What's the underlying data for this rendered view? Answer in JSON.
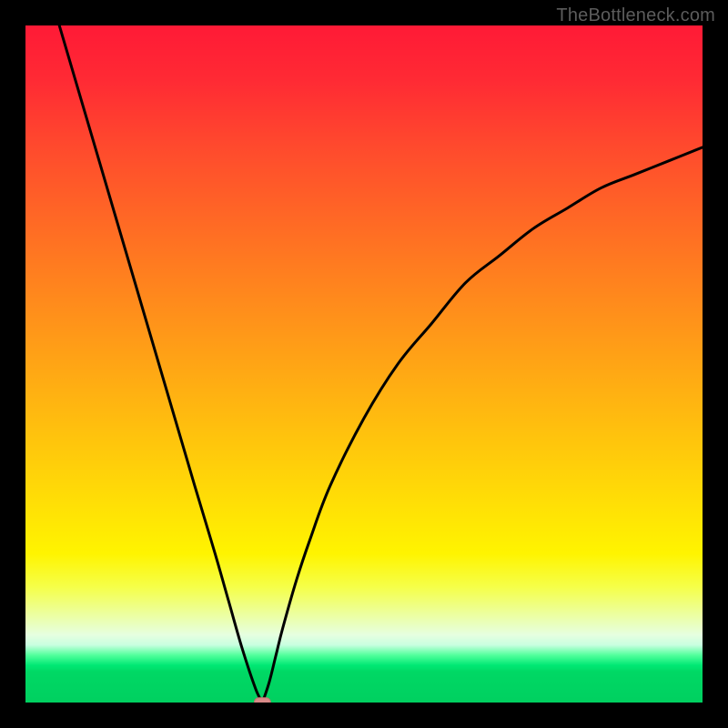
{
  "watermark": {
    "text": "TheBottleneck.com"
  },
  "colors": {
    "curve": "#000000",
    "marker_fill": "#d88a88",
    "marker_stroke": "#c37572"
  },
  "chart_data": {
    "type": "line",
    "title": "",
    "xlabel": "",
    "ylabel": "",
    "xlim": [
      0,
      100
    ],
    "ylim": [
      0,
      100
    ],
    "grid": false,
    "legend": false,
    "annotations": [
      {
        "text": "TheBottleneck.com",
        "position": "top-right"
      }
    ],
    "series": [
      {
        "name": "left-branch",
        "x": [
          5,
          10,
          15,
          20,
          25,
          28,
          30,
          32,
          34,
          35
        ],
        "y": [
          100,
          83,
          66,
          49,
          32,
          22,
          15,
          8,
          2,
          0
        ]
      },
      {
        "name": "right-branch",
        "x": [
          35,
          36,
          37,
          38,
          40,
          42,
          45,
          50,
          55,
          60,
          65,
          70,
          75,
          80,
          85,
          90,
          95,
          100
        ],
        "y": [
          0,
          3,
          7,
          11,
          18,
          24,
          32,
          42,
          50,
          56,
          62,
          66,
          70,
          73,
          76,
          78,
          80,
          82
        ]
      }
    ],
    "marker": {
      "x": 35,
      "y": 0,
      "shape": "rounded-rect",
      "w": 2.4,
      "h": 1.4
    }
  }
}
